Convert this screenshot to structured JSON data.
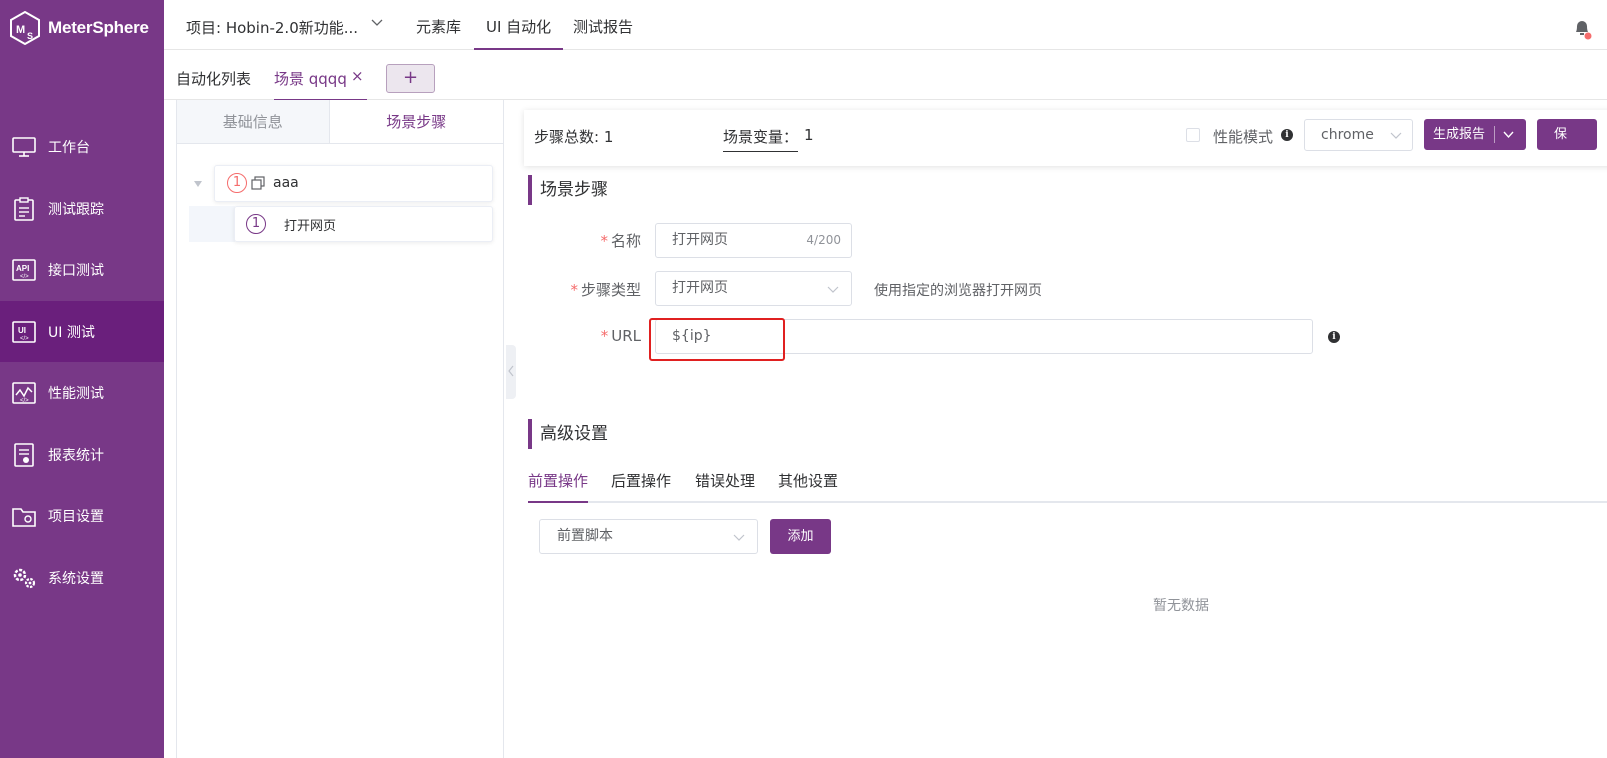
{
  "app": {
    "name": "MeterSphere",
    "brand_color": "#783887"
  },
  "sidebar": {
    "items": [
      {
        "label": "工作台",
        "icon": "monitor-icon"
      },
      {
        "label": "测试跟踪",
        "icon": "clipboard-icon"
      },
      {
        "label": "接口测试",
        "icon": "api-icon"
      },
      {
        "label": "UI 测试",
        "icon": "ui-icon",
        "active": true
      },
      {
        "label": "性能测试",
        "icon": "chart-icon"
      },
      {
        "label": "报表统计",
        "icon": "report-icon"
      },
      {
        "label": "项目设置",
        "icon": "folder-icon"
      },
      {
        "label": "系统设置",
        "icon": "gears-icon"
      }
    ]
  },
  "header": {
    "project": "项目: Hobin-2.0新功能...",
    "menus": [
      "元素库",
      "UI 自动化",
      "测试报告"
    ],
    "active_menu": "UI 自动化"
  },
  "tabs": {
    "list_label": "自动化列表",
    "scene_tab": "场景 qqqq",
    "close": "×",
    "add": "+"
  },
  "left_panel": {
    "tabs": [
      "基础信息",
      "场景步骤"
    ],
    "active_tab": "场景步骤",
    "tree": [
      {
        "index": "1",
        "label": "aaa"
      },
      {
        "index": "1",
        "label": "打开网页"
      }
    ]
  },
  "step_header": {
    "total_label": "步骤总数: 1",
    "var_label": "场景变量：",
    "var_value": "1",
    "perf_label": "性能模式",
    "browser": "chrome",
    "report_btn": "生成报告",
    "save_btn": "保"
  },
  "form": {
    "section_title": "场景步骤",
    "name_label": "名称",
    "name_value": "打开网页",
    "name_counter": "4/200",
    "type_label": "步骤类型",
    "type_value": "打开网页",
    "type_hint": "使用指定的浏览器打开网页",
    "url_label": "URL",
    "url_value": "${ip}"
  },
  "advanced": {
    "title": "高级设置",
    "tabs": [
      "前置操作",
      "后置操作",
      "错误处理",
      "其他设置"
    ],
    "active_tab": "前置操作",
    "script_select": "前置脚本",
    "add_btn": "添加",
    "empty_text": "暂无数据"
  }
}
